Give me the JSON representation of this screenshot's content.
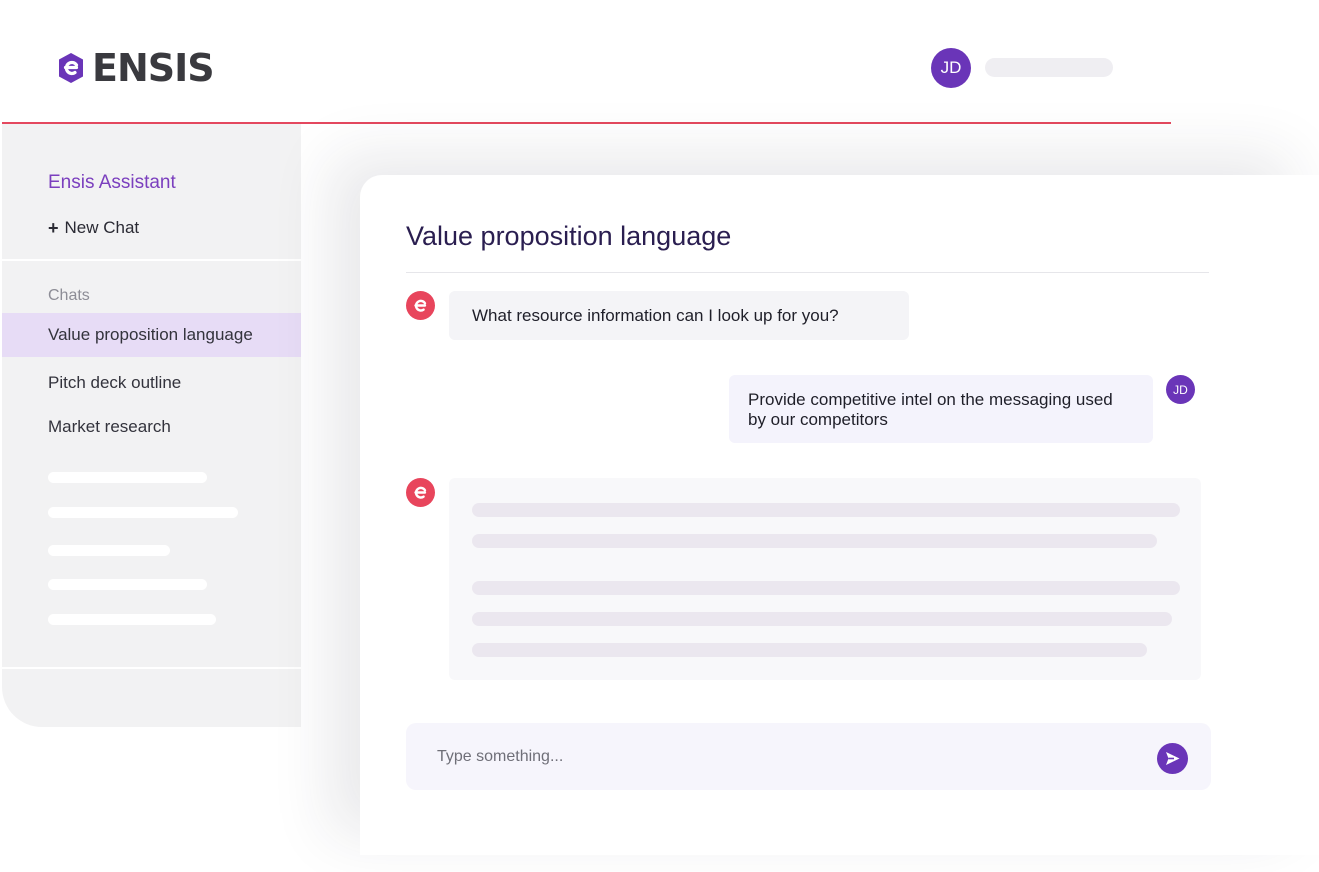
{
  "header": {
    "logo_text": "ENSIS",
    "avatar_initials": "JD"
  },
  "sidebar": {
    "title": "Ensis Assistant",
    "new_chat_icon": "plus-icon",
    "new_chat_label": "New Chat",
    "section_label": "Chats",
    "items": [
      {
        "label": "Value proposition language",
        "active": true
      },
      {
        "label": "Pitch deck outline",
        "active": false
      },
      {
        "label": "Market research",
        "active": false
      }
    ]
  },
  "chat": {
    "title": "Value proposition language",
    "messages": [
      {
        "role": "assistant",
        "text": "What resource information can I look up for you?"
      },
      {
        "role": "user",
        "text": "Provide competitive intel on the messaging used by our competitors",
        "avatar": "JD"
      },
      {
        "role": "assistant",
        "text": "",
        "loading": true
      }
    ],
    "input": {
      "placeholder": "Type something...",
      "value": ""
    },
    "send_icon": "send-icon"
  },
  "colors": {
    "accent_purple": "#6a35b8",
    "brand_red": "#e8455c",
    "active_item_bg": "#e7dcf6",
    "header_line": "#e4485f"
  }
}
